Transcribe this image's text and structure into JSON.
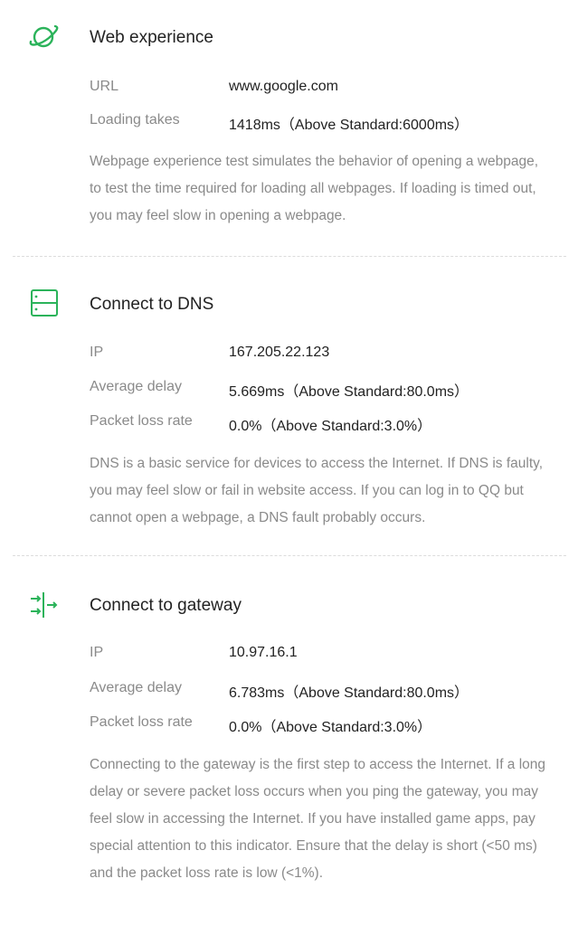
{
  "theme": {
    "accent": "#2bb35a"
  },
  "web_experience": {
    "icon": "planet-icon",
    "title": "Web experience",
    "url_label": "URL",
    "url_value": "www.google.com",
    "loading_label": "Loading takes",
    "loading_value": "1418ms（Above Standard:6000ms）",
    "description": "Webpage experience test simulates the behavior of opening a webpage, to test the time required for loading all webpages. If loading is timed out, you may feel slow in opening a webpage."
  },
  "dns": {
    "icon": "server-icon",
    "title": "Connect to DNS",
    "ip_label": "IP",
    "ip_value": "167.205.22.123",
    "delay_label": "Average delay",
    "delay_value": "5.669ms（Above Standard:80.0ms）",
    "loss_label": "Packet loss rate",
    "loss_value": "0.0%（Above Standard:3.0%）",
    "description": "DNS is a basic service for devices to access the Internet. If DNS is faulty, you may feel slow or fail in website access. If you can log in to QQ but cannot open a webpage, a DNS fault probably occurs."
  },
  "gateway": {
    "icon": "gateway-icon",
    "title": "Connect to gateway",
    "ip_label": "IP",
    "ip_value": "10.97.16.1",
    "delay_label": "Average delay",
    "delay_value": "6.783ms（Above Standard:80.0ms）",
    "loss_label": "Packet loss rate",
    "loss_value": "0.0%（Above Standard:3.0%）",
    "description": "Connecting to the gateway is the first step to access the Internet. If a long delay or severe packet loss occurs when you ping the gateway, you may feel slow in accessing the Internet. If you have installed game apps, pay special attention to this indicator. Ensure that the delay is short (<50 ms) and the packet loss rate is low (<1%)."
  }
}
